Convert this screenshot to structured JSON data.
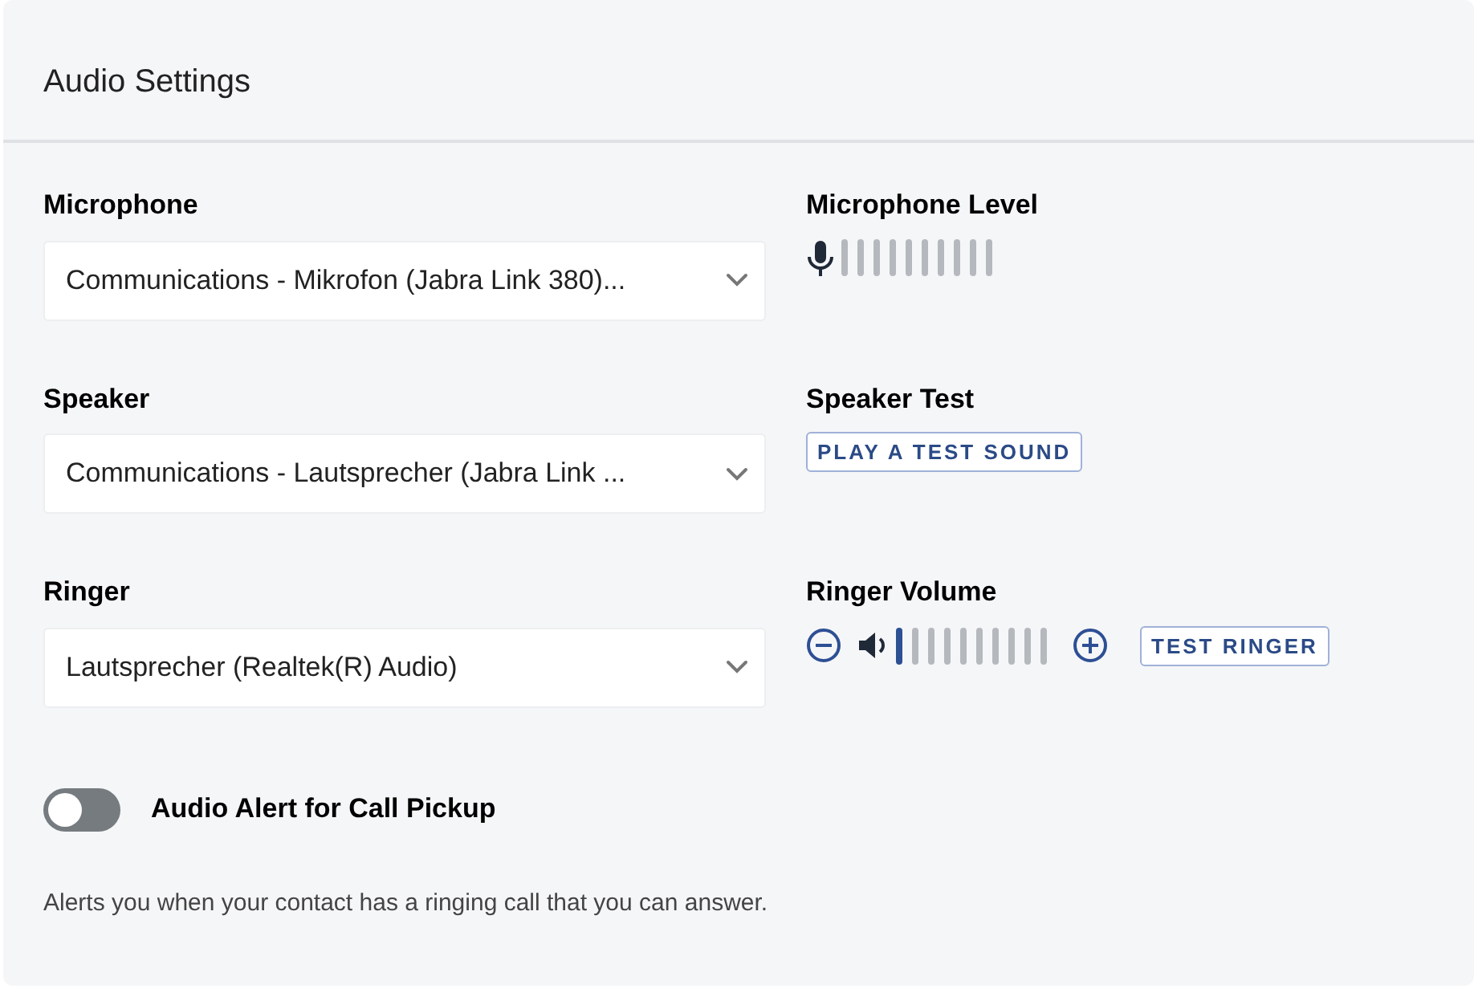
{
  "title": "Audio Settings",
  "devices": [
    {
      "label": "Microphone",
      "value": "Communications - Mikrofon (Jabra Link 380)..."
    },
    {
      "label": "Speaker",
      "value": "Communications - Lautsprecher (Jabra Link ..."
    },
    {
      "label": "Ringer",
      "value": "Lautsprecher (Realtek(R) Audio)"
    }
  ],
  "microphone_level": {
    "label": "Microphone Level"
  },
  "speaker_test": {
    "label": "Speaker Test",
    "button": "PLAY A TEST SOUND"
  },
  "ringer_volume": {
    "label": "Ringer Volume",
    "level": 0.1,
    "button": "TEST RINGER"
  },
  "alert": {
    "label": "Audio Alert for Call Pickup",
    "on": false,
    "description": "Alerts you when your contact has a ringing call that you can answer."
  }
}
